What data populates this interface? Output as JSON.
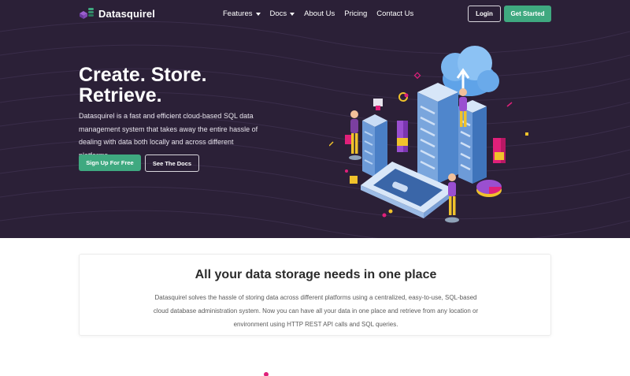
{
  "brand": {
    "name": "Datasquirel",
    "icon": "database-cube-icon"
  },
  "nav": {
    "items": [
      {
        "label": "Features",
        "has_dropdown": true
      },
      {
        "label": "Docs",
        "has_dropdown": true
      },
      {
        "label": "About Us",
        "has_dropdown": false
      },
      {
        "label": "Pricing",
        "has_dropdown": false
      },
      {
        "label": "Contact Us",
        "has_dropdown": false
      }
    ],
    "login_label": "Login",
    "get_started_label": "Get Started"
  },
  "hero": {
    "title_line1": "Create. Store.",
    "title_line2": "Retrieve.",
    "text": "Datasquirel is a fast and efficient cloud-based SQL data management system that takes away the entire hassle of dealing with data both locally and across different platforms.",
    "primary_cta": "Sign Up For Free",
    "secondary_cta": "See The Docs"
  },
  "feature": {
    "title": "All your data storage needs in one place",
    "text": "Datasquirel solves the hassle of storing data across different platforms using a centralized, easy-to-use, SQL-based cloud database administration system. Now you can have all your data in one place and retrieve from any location or environment using HTTP REST API calls and SQL queries."
  },
  "colors": {
    "hero_bg": "#2b2037",
    "accent_green": "#3fa980",
    "accent_pink": "#e0207a",
    "accent_purple": "#7b3fa0",
    "accent_blue": "#4a8fd6"
  }
}
